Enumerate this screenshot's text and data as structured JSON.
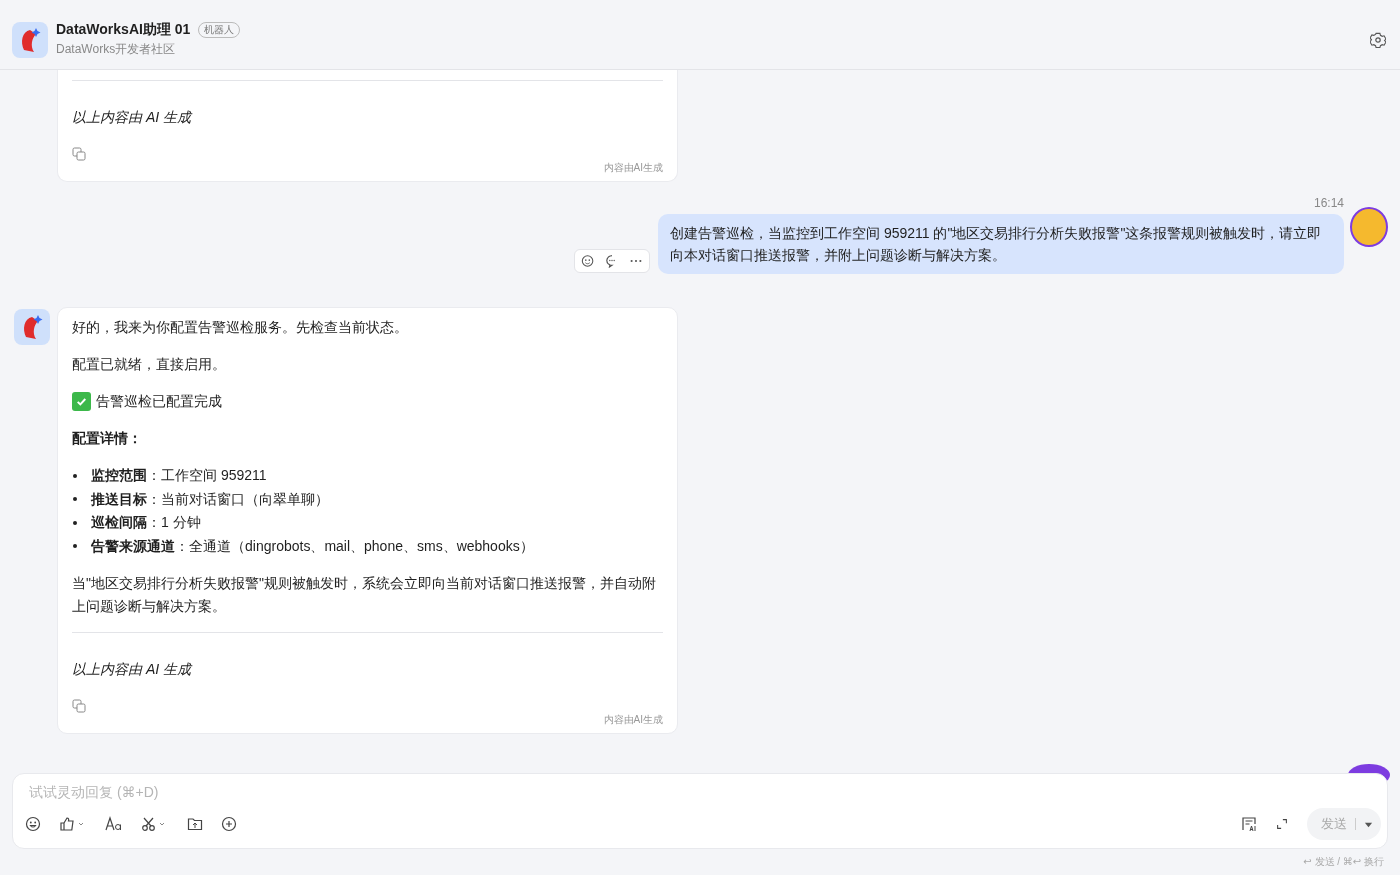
{
  "header": {
    "title": "DataWorksAI助理 01",
    "badge": "机器人",
    "subtitle": "DataWorks开发者社区"
  },
  "messages": [
    {
      "kind": "bot_tail",
      "footer_note": "以上内容由 AI 生成",
      "watermark": "内容由AI生成"
    },
    {
      "kind": "user",
      "time": "16:14",
      "text": "创建告警巡检，当监控到工作空间 959211 的\"地区交易排行分析失败报警\"这条报警规则被触发时，请立即向本对话窗口推送报警，并附上问题诊断与解决方案。"
    },
    {
      "kind": "bot",
      "blocks": [
        {
          "kind": "para",
          "text": "好的，我来为你配置告警巡检服务。先检查当前状态。"
        },
        {
          "kind": "para",
          "text": "配置已就绪，直接启用。"
        },
        {
          "kind": "status",
          "text": "告警巡检已配置完成"
        },
        {
          "kind": "heading",
          "text": "配置详情："
        },
        {
          "kind": "bullets",
          "items": [
            "**监控范围**：工作空间 959211",
            "**推送目标**：当前对话窗口（向翠单聊）",
            "**巡检间隔**：1 分钟",
            "**告警来源通道**：全通道（dingrobots、mail、phone、sms、webhooks）"
          ]
        },
        {
          "kind": "para",
          "text": "当\"地区交易排行分析失败报警\"规则被触发时，系统会立即向当前对话窗口推送报警，并自动附上问题诊断与解决方案。"
        }
      ],
      "footer_note": "以上内容由 AI 生成",
      "watermark": "内容由AI生成"
    }
  ],
  "composer": {
    "placeholder": "试试灵动回复 (⌘+D)",
    "send_label": "发送",
    "hint": "↩ 发送 / ⌘↩ 换行"
  }
}
